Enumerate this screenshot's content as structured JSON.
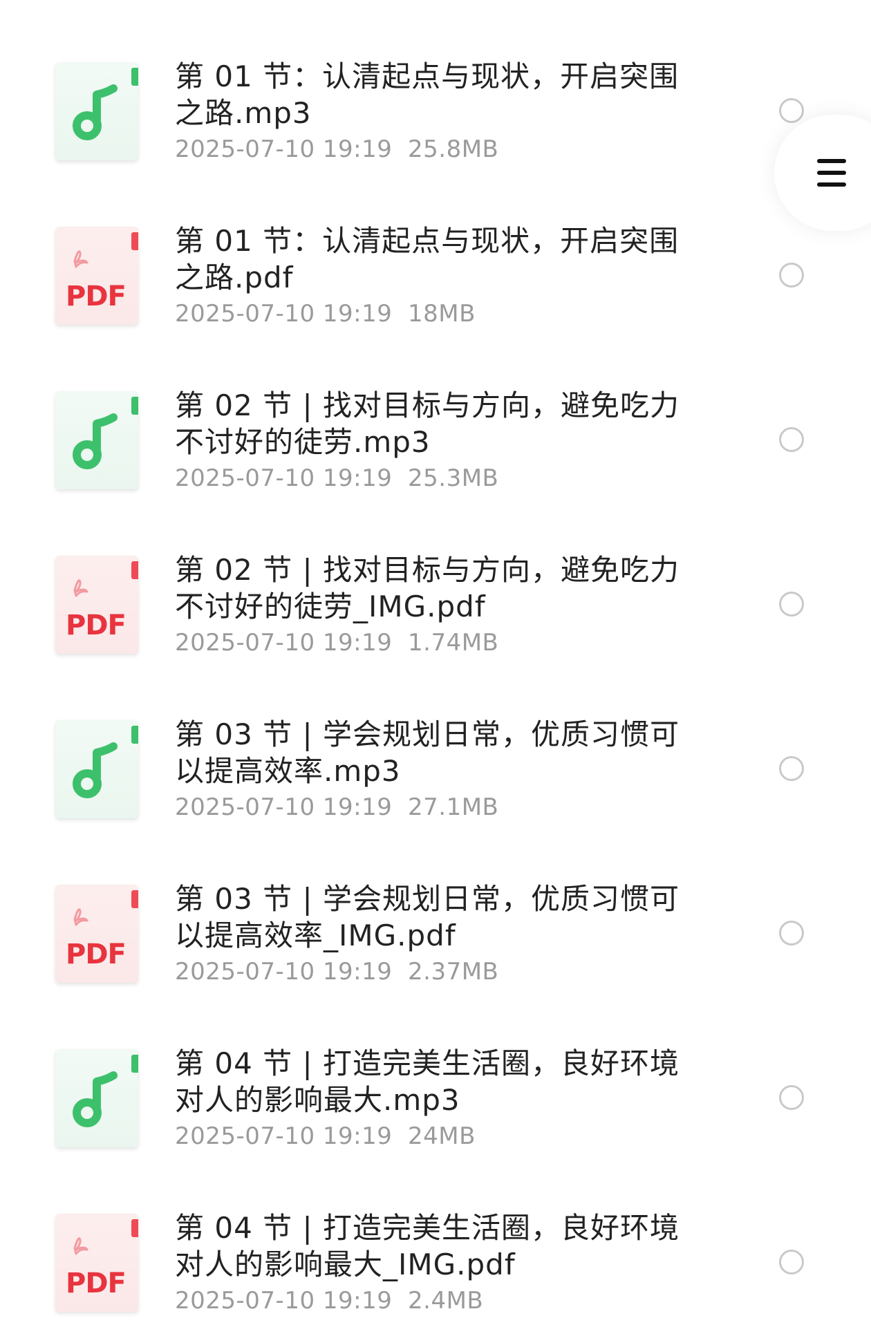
{
  "files": [
    {
      "type": "audio",
      "title": "第 01 节：认清起点与现状，开启突围之路.mp3",
      "date": "2025-07-10 19:19",
      "size": "25.8MB"
    },
    {
      "type": "pdf",
      "title": "第 01 节：认清起点与现状，开启突围之路.pdf",
      "date": "2025-07-10 19:19",
      "size": "18MB"
    },
    {
      "type": "audio",
      "title": "第 02 节 | 找对目标与方向，避免吃力不讨好的徒劳.mp3",
      "date": "2025-07-10 19:19",
      "size": "25.3MB"
    },
    {
      "type": "pdf",
      "title": "第 02 节 | 找对目标与方向，避免吃力不讨好的徒劳_IMG.pdf",
      "date": "2025-07-10 19:19",
      "size": "1.74MB"
    },
    {
      "type": "audio",
      "title": "第 03 节 | 学会规划日常，优质习惯可以提高效率.mp3",
      "date": "2025-07-10 19:19",
      "size": "27.1MB"
    },
    {
      "type": "pdf",
      "title": "第 03 节 | 学会规划日常，优质习惯可以提高效率_IMG.pdf",
      "date": "2025-07-10 19:19",
      "size": "2.37MB"
    },
    {
      "type": "audio",
      "title": "第 04 节 | 打造完美生活圈，良好环境对人的影响最大.mp3",
      "date": "2025-07-10 19:19",
      "size": "24MB"
    },
    {
      "type": "pdf",
      "title": "第 04 节 | 打造完美生活圈，良好环境对人的影响最大_IMG.pdf",
      "date": "2025-07-10 19:19",
      "size": "2.4MB"
    }
  ],
  "icons": {
    "audio": "music-note-icon",
    "pdf": "pdf-file-icon",
    "menu": "menu-icon"
  },
  "pdf_icon_label": "PDF",
  "colors": {
    "audio_accent": "#3dc06c",
    "pdf_accent": "#e8343f",
    "title_text": "#222222",
    "meta_text": "#9a9a9a",
    "radio_border": "#c9c9c9"
  }
}
